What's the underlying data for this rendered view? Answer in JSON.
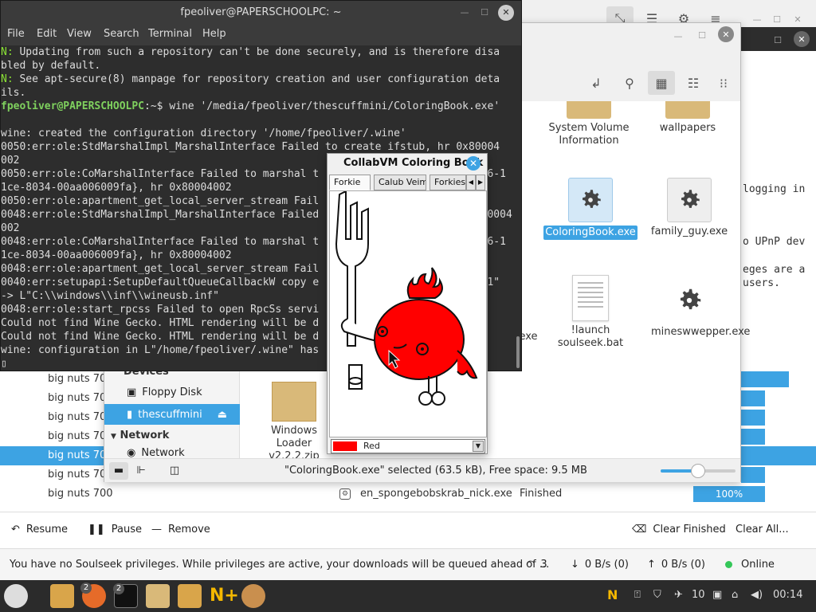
{
  "terminal": {
    "title": "fpeoliver@PAPERSCHOOLPC: ~",
    "menu": [
      "File",
      "Edit",
      "View",
      "Search",
      "Terminal",
      "Help"
    ],
    "lines": [
      {
        "pre": "N: ",
        "text": "Updating from such a repository can't be done securely, and is therefore disa"
      },
      {
        "pre": "",
        "text": "bled by default."
      },
      {
        "pre": "N: ",
        "text": "See apt-secure(8) manpage for repository creation and user configuration deta"
      },
      {
        "pre": "",
        "text": "ils."
      },
      {
        "prompt": "fpeoliver@PAPERSCHOOLPC",
        "prompt_tail": ":~$ ",
        "text": "wine '/media/fpeoliver/thescuffmini/ColoringBook.exe'"
      },
      {
        "pre": "",
        "text": ""
      },
      {
        "pre": "",
        "text": "wine: created the configuration directory '/home/fpeoliver/.wine'"
      },
      {
        "pre": "",
        "text": "0050:err:ole:StdMarshalImpl_MarshalInterface Failed to create ifstub, hr 0x80004"
      },
      {
        "pre": "",
        "text": "002"
      },
      {
        "pre": "",
        "text": "0050:err:ole:CoMarshalInterface Failed to marshal t                          86-1"
      },
      {
        "pre": "",
        "text": "1ce-8034-00aa006009fa}, hr 0x80004002"
      },
      {
        "pre": "",
        "text": "0050:err:ole:apartment_get_local_server_stream Fail"
      },
      {
        "pre": "",
        "text": "0048:err:ole:StdMarshalImpl_MarshalInterface Failed                           0004"
      },
      {
        "pre": "",
        "text": "002"
      },
      {
        "pre": "",
        "text": "0048:err:ole:CoMarshalInterface Failed to marshal t                          86-1"
      },
      {
        "pre": "",
        "text": "1ce-8034-00aa006009fa}, hr 0x80004002"
      },
      {
        "pre": "",
        "text": "0048:err:ole:apartment_get_local_server_stream Fail"
      },
      {
        "pre": "",
        "text": "0040:err:setupapi:SetupDefaultQueueCallbackW copy e                          -1\""
      },
      {
        "pre": "",
        "text": "-> L\"C:\\\\windows\\\\inf\\\\wineusb.inf\""
      },
      {
        "pre": "",
        "text": "0048:err:ole:start_rpcss Failed to open RpcSs servi"
      },
      {
        "pre": "",
        "text": "Could not find Wine Gecko. HTML rendering will be d"
      },
      {
        "pre": "",
        "text": "Could not find Wine Gecko. HTML rendering will be d"
      },
      {
        "pre": "",
        "text": "wine: configuration in L\"/home/fpeoliver/.wine\" has"
      },
      {
        "pre": "",
        "text": "▯"
      }
    ]
  },
  "nemo": {
    "files": [
      {
        "label": "System Volume Information",
        "kind": "folder"
      },
      {
        "label": "wallpapers",
        "kind": "folder"
      },
      {
        "label": "ColoringBook.exe",
        "kind": "exe",
        "selected": true
      },
      {
        "label": "family_guy.exe",
        "kind": "exe"
      },
      {
        "label": "exe",
        "kind": "partial"
      },
      {
        "label": "!launch soulseek.bat",
        "kind": "doc"
      },
      {
        "label": "mineswwepper.exe",
        "kind": "exe"
      },
      {
        "label": "Windows Loader v2.2.2.zip",
        "kind": "zip"
      }
    ],
    "sidebar": {
      "devices_header": "Devices",
      "floppy": "Floppy Disk",
      "usb": "thescuffmini",
      "network_header": "Network",
      "network": "Network"
    },
    "status": "\"ColoringBook.exe\" selected (63.5 kB), Free space: 9.5 MB"
  },
  "coloring_book": {
    "title": "CollabVM Coloring Book",
    "tabs": [
      "Forkie",
      "Calub Veim",
      "Forkies"
    ],
    "color_name": "Red",
    "color_hex": "#ff0000"
  },
  "soulseek": {
    "rows": [
      {
        "user": "big nuts 700"
      },
      {
        "user": "big nuts 700"
      },
      {
        "user": "big nuts 700"
      },
      {
        "user": "big nuts 700"
      },
      {
        "user": "big nuts 700",
        "selected": true
      },
      {
        "user": "big nuts 700"
      },
      {
        "user": "big nuts 700",
        "file": "en_spongebobskrab_nick.exe",
        "status": "Finished",
        "progress": "100%"
      }
    ],
    "right_text": [
      "logging in",
      "o UPnP dev",
      "eges are a",
      "users."
    ],
    "actions": {
      "resume": "Resume",
      "pause": "Pause",
      "remove": "Remove",
      "clear_finished": "Clear Finished",
      "clear_all": "Clear All..."
    },
    "status": {
      "message": "You have no Soulseek privileges. While privileges are active, your downloads will be queued ahead of ...",
      "connections": "3",
      "down": "0 B/s (0)",
      "up": "0 B/s (0)",
      "online": "Online"
    }
  },
  "taskbar": {
    "badge_firefox": "2",
    "badge_terminal": "2",
    "volume": "10",
    "clock": "00:14"
  },
  "colors": {
    "accent": "#3da3e3",
    "terminal_bg": "#2d2d2d",
    "taskbar_bg": "#2b2b2b",
    "online": "#35c759"
  }
}
